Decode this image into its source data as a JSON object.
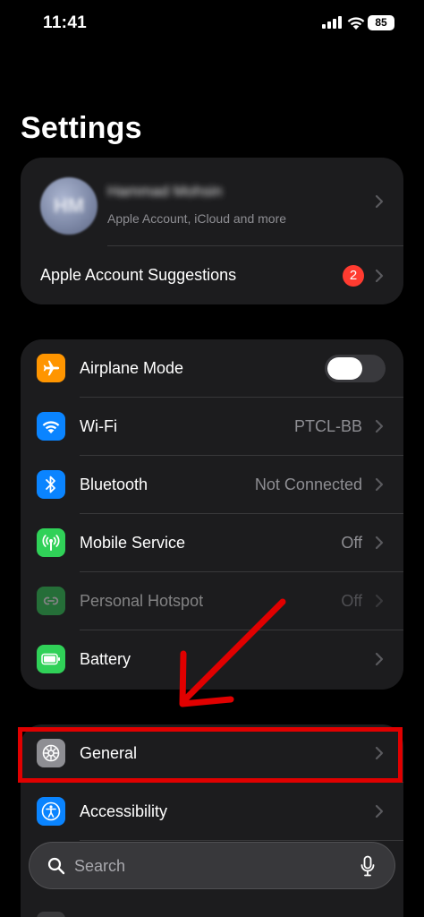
{
  "status_bar": {
    "time": "11:41",
    "battery": "85"
  },
  "page_title": "Settings",
  "account": {
    "avatar_initials": "HM",
    "name": "Hammad Mohsin",
    "subtitle": "Apple Account, iCloud and more",
    "suggestions_label": "Apple Account Suggestions",
    "suggestions_badge": "2"
  },
  "connectivity": [
    {
      "label": "Airplane Mode",
      "value": "",
      "icon": "airplane-icon",
      "color": "#ff9500",
      "toggle": false
    },
    {
      "label": "Wi-Fi",
      "value": "PTCL-BB",
      "icon": "wifi-icon",
      "color": "#0a84ff"
    },
    {
      "label": "Bluetooth",
      "value": "Not Connected",
      "icon": "bluetooth-icon",
      "color": "#0a84ff"
    },
    {
      "label": "Mobile Service",
      "value": "Off",
      "icon": "antenna-icon",
      "color": "#30d158"
    },
    {
      "label": "Personal Hotspot",
      "value": "Off",
      "icon": "hotspot-icon",
      "color": "#30d158",
      "disabled": true
    },
    {
      "label": "Battery",
      "value": "",
      "icon": "battery-icon",
      "color": "#30d158"
    }
  ],
  "general": [
    {
      "label": "General",
      "icon": "gear-icon",
      "color": "#8e8e93"
    },
    {
      "label": "Accessibility",
      "icon": "accessibility-icon",
      "color": "#0a84ff"
    }
  ],
  "search": {
    "placeholder": "Search"
  },
  "colors": {
    "background": "#000000",
    "group": "#1c1c1e",
    "annotation": "#e00000",
    "badge": "#ff3b30"
  }
}
